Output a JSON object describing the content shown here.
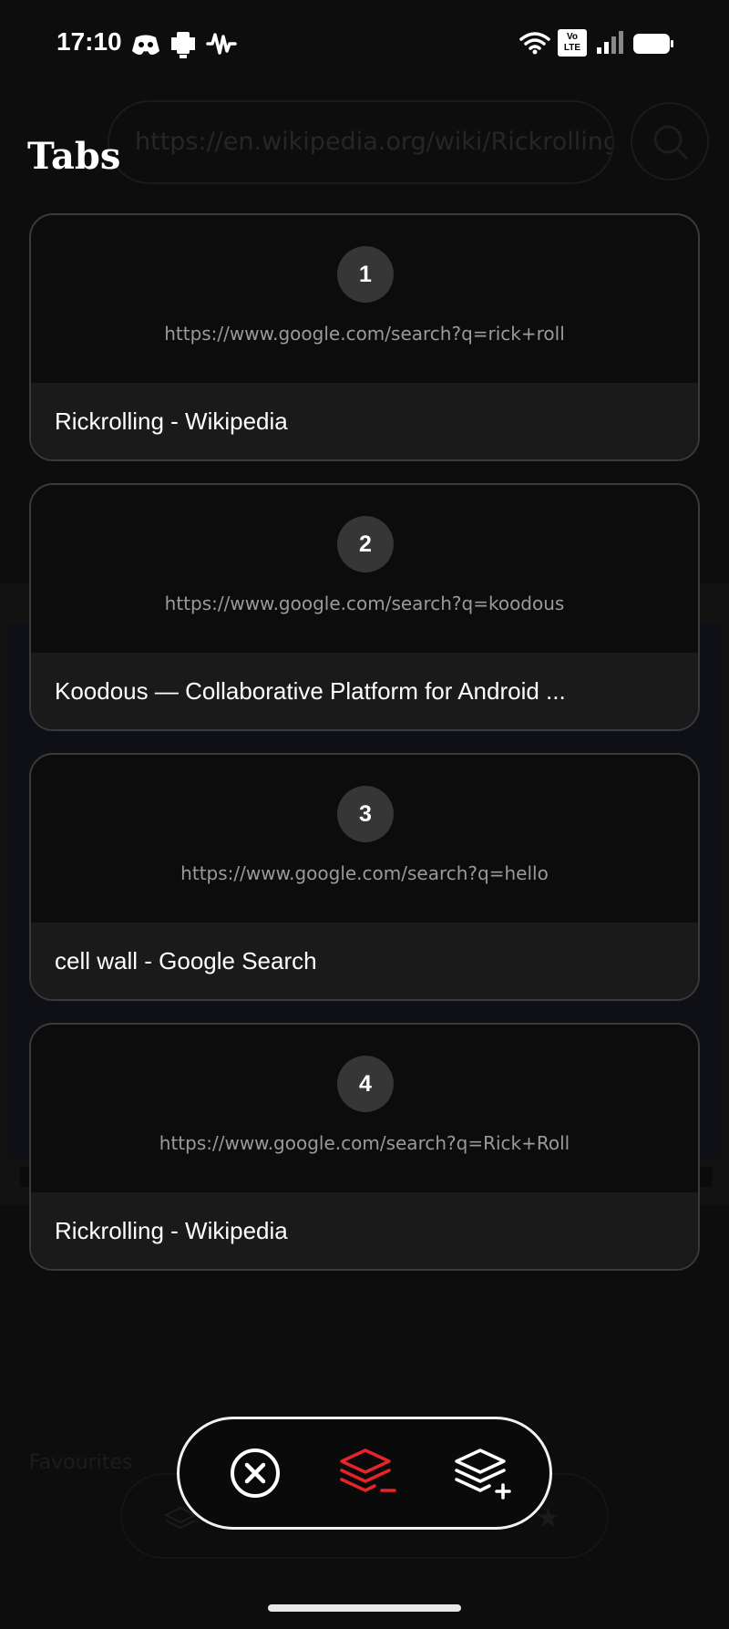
{
  "status_bar": {
    "time": "17:10",
    "volte_label_top": "Vo",
    "volte_label_bottom": "LTE"
  },
  "background": {
    "url_text": "https://en.wikipedia.org/wiki/Rickrolling",
    "favourites_text": "Favourites"
  },
  "header": {
    "title": "Tabs"
  },
  "tabs": [
    {
      "number": "1",
      "url": "https://www.google.com/search?q=rick+roll",
      "title": "Rickrolling - Wikipedia"
    },
    {
      "number": "2",
      "url": "https://www.google.com/search?q=koodous",
      "title": "Koodous — Collaborative Platform for Android ..."
    },
    {
      "number": "3",
      "url": "https://www.google.com/search?q=hello",
      "title": "cell wall - Google Search"
    },
    {
      "number": "4",
      "url": "https://www.google.com/search?q=Rick+Roll",
      "title": "Rickrolling - Wikipedia"
    }
  ],
  "action_bar": {
    "icons": [
      "close-circle-icon",
      "layers-minus-icon",
      "layers-plus-icon"
    ],
    "accent_color": "#e8232a"
  }
}
